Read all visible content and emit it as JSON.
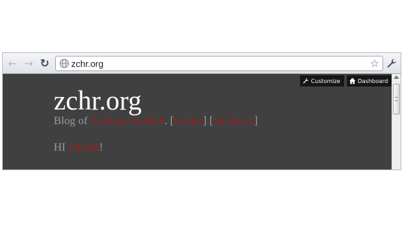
{
  "browser": {
    "url": "zchr.org",
    "icons": {
      "back": "back-arrow-icon",
      "forward": "forward-arrow-icon",
      "reload": "reload-icon",
      "site": "globe-icon",
      "bookmark": "star-icon",
      "menu": "wrench-icon"
    }
  },
  "admin_bar": {
    "customize_label": "Customize",
    "dashboard_label": "Dashboard"
  },
  "page": {
    "title": "zchr.org",
    "tagline_prefix": "Blog of ",
    "author_link": "Zachary Reddell",
    "tagline_sep": ". [",
    "twitter_link": "twitter",
    "tagline_mid": "] [",
    "facebook_link": "facebook",
    "tagline_end": "]",
    "greeting_prefix": "HI ",
    "greeting_link": "URDB",
    "greeting_suffix": "!"
  },
  "colors": {
    "page_background": "#404040",
    "link_red": "#9c1e1e",
    "tagline_gray": "#9a9a9a"
  }
}
